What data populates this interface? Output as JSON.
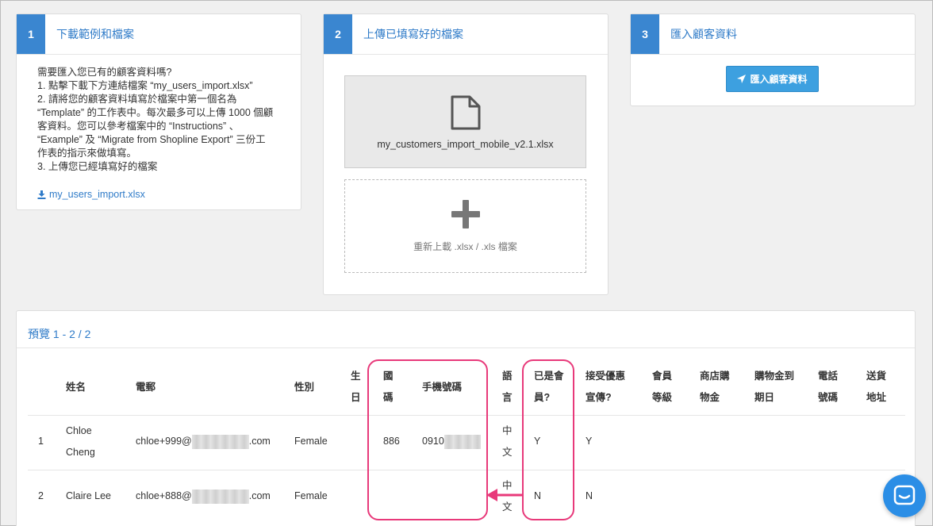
{
  "step1": {
    "number": "1",
    "title": "下載範例和檔案",
    "lines": [
      "需要匯入您已有的顧客資料嗎?",
      "1. 點擊下載下方連結檔案 “my_users_import.xlsx”",
      "2. 請將您的顧客資料填寫於檔案中第一個名為",
      "“Template” 的工作表中。每次最多可以上傳 1000 個顧",
      "客資料。您可以參考檔案中的 “Instructions” 、",
      "“Example” 及 “Migrate from Shopline Export” 三份工",
      "作表的指示來做填寫。",
      "3. 上傳您已經填寫好的檔案"
    ],
    "download_link": "my_users_import.xlsx",
    "download_icon": "download-icon"
  },
  "step2": {
    "number": "2",
    "title": "上傳已填寫好的檔案",
    "file_name": "my_customers_import_mobile_v2.1.xlsx",
    "file_icon": "file-icon",
    "reupload_text": "重新上載 .xlsx / .xls 檔案",
    "plus_icon": "plus-icon"
  },
  "step3": {
    "number": "3",
    "title": "匯入顧客資料",
    "button_label": "匯入顧客資料",
    "button_icon": "rocket-icon"
  },
  "preview": {
    "title": "預覽 1 - 2 / 2",
    "headers": {
      "name": "姓名",
      "email": "電郵",
      "gender": "性別",
      "birthday_l1": "生",
      "birthday_l2": "日",
      "country_l1": "國",
      "country_l2": "碼",
      "mobile": "手機號碼",
      "lang_l1": "語",
      "lang_l2": "言",
      "member_l1": "已是會",
      "member_l2": "員?",
      "promo_l1": "接受優惠",
      "promo_l2": "宣傳?",
      "tier_l1": "會員",
      "tier_l2": "等級",
      "credit_l1": "商店購",
      "credit_l2": "物金",
      "expiry_l1": "購物金到",
      "expiry_l2": "期日",
      "phone_l1": "電話",
      "phone_l2": "號碼",
      "address_l1": "送貨",
      "address_l2": "地址"
    },
    "rows": [
      {
        "index": "1",
        "name_l1": "Chloe",
        "name_l2": "Cheng",
        "email_prefix": "chloe+999@",
        "email_suffix": ".com",
        "gender": "Female",
        "country": "886",
        "mobile_prefix": "0910",
        "lang_l1": "中",
        "lang_l2": "文",
        "member": "Y",
        "promo": "Y"
      },
      {
        "index": "2",
        "name": "Claire Lee",
        "email_prefix": "chloe+888@",
        "email_suffix": ".com",
        "gender": "Female",
        "lang_l1": "中",
        "lang_l2": "文",
        "member": "N",
        "promo": "N"
      }
    ]
  },
  "colors": {
    "accent": "#3a86d0",
    "link": "#2f7bc8",
    "highlight": "#e8397a",
    "chat": "#2b8ee6"
  },
  "chat_icon": "chat-icon"
}
